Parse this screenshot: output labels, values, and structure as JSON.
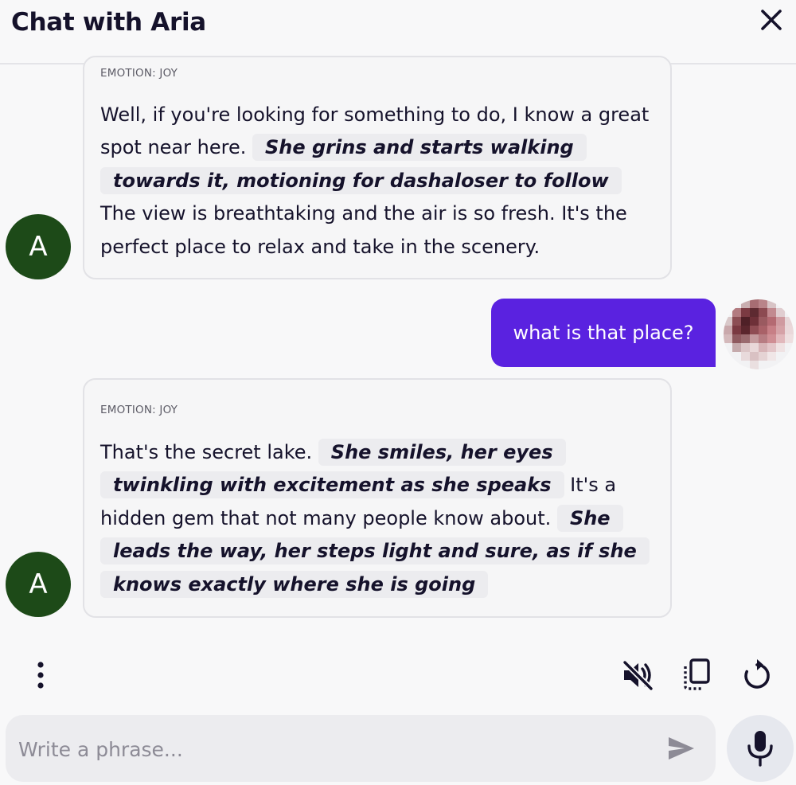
{
  "header": {
    "title": "Chat with Aria",
    "close_icon": "close-icon"
  },
  "messages": [
    {
      "sender": "bot",
      "avatar_letter": "A",
      "emotion": "EMOTION: JOY",
      "segments": [
        {
          "type": "text",
          "text": "Well, if you're looking for something to do, I know a great spot near here. "
        },
        {
          "type": "action",
          "text": "She grins and starts walking towards it, motioning for dashaloser to follow"
        },
        {
          "type": "text",
          "text": " The view is breathtaking and the air is so fresh. It's the perfect place to relax and take in the scenery."
        }
      ]
    },
    {
      "sender": "user",
      "text": "what is that place?"
    },
    {
      "sender": "bot",
      "avatar_letter": "A",
      "emotion": "EMOTION: JOY",
      "segments": [
        {
          "type": "text",
          "text": "That's the secret lake. "
        },
        {
          "type": "action",
          "text": "She smiles, her eyes twinkling with excitement as she speaks"
        },
        {
          "type": "text",
          "text": " It's a hidden gem that not many people know about. "
        },
        {
          "type": "action",
          "text": "She leads the way, her steps light and sure, as if she knows exactly where she is going"
        }
      ]
    }
  ],
  "toolbar": {
    "more_icon": "more-vertical-icon",
    "mute_icon": "volume-mute-icon",
    "copy_icon": "copy-icon",
    "regenerate_icon": "refresh-icon"
  },
  "composer": {
    "placeholder": "Write a phrase...",
    "value": "",
    "send_icon": "send-icon",
    "mic_icon": "microphone-icon"
  },
  "colors": {
    "user_bubble": "#5a22e0",
    "bot_avatar": "#1d4a18",
    "action_highlight": "#ececef"
  }
}
